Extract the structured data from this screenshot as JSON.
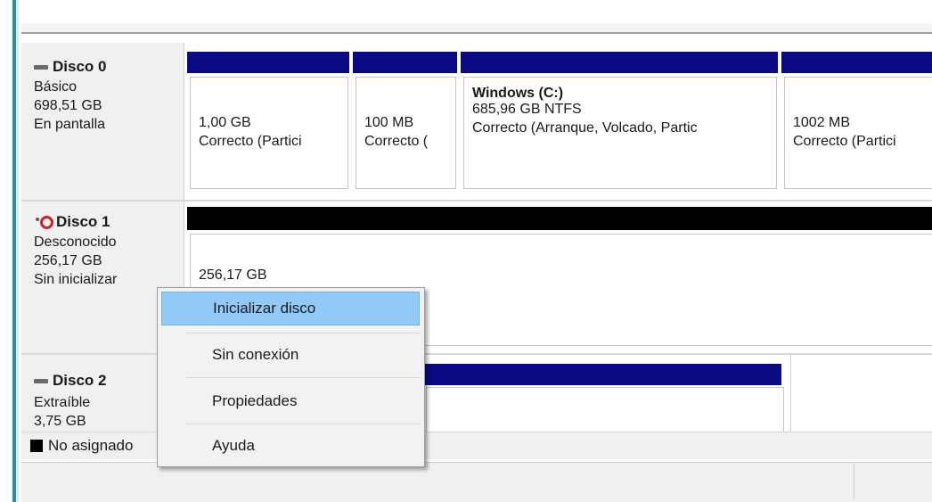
{
  "disks": [
    {
      "title": "Disco 0",
      "icon": "disk-icon",
      "lines": [
        "Básico",
        "698,51 GB",
        "En pantalla"
      ],
      "partitions": [
        {
          "name": "",
          "size": "1,00 GB",
          "status": "Correcto (Partici"
        },
        {
          "name": "",
          "size": "100 MB",
          "status": "Correcto ("
        },
        {
          "name": "Windows  (C:)",
          "size": "685,96 GB NTFS",
          "status": "Correcto (Arranque, Volcado, Partic"
        },
        {
          "name": "",
          "size": "1002 MB",
          "status": "Correcto (Partici"
        }
      ]
    },
    {
      "title": "Disco 1",
      "icon": "warning-icon",
      "lines": [
        "Desconocido",
        "256,17 GB",
        "Sin inicializar"
      ],
      "partitions": [
        {
          "name": "",
          "size": "256,17 GB",
          "status": ""
        }
      ]
    },
    {
      "title": "Disco 2",
      "icon": "disk-icon",
      "lines": [
        "Extraíble",
        "3,75 GB"
      ],
      "partitions": []
    }
  ],
  "legend": {
    "unallocated": "No asignado"
  },
  "context_menu": {
    "items": [
      "Inicializar disco",
      "Sin conexión",
      "Propiedades",
      "Ayuda"
    ],
    "highlighted": 0
  },
  "colors": {
    "partition_bar": "#0a0a84",
    "unknown_bar": "#000000",
    "menu_highlight": "#91c9f7",
    "frame_accent": "#2f8f95"
  }
}
